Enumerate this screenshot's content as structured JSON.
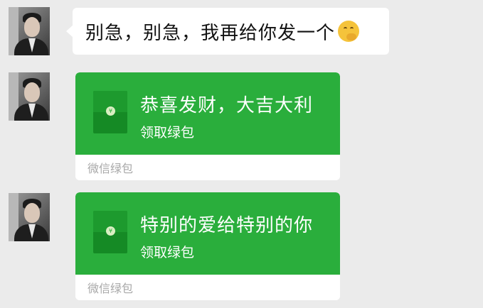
{
  "messages": [
    {
      "type": "text",
      "text": "别急，别急，我再给你发一个",
      "emoji": "thinking-face-emoji"
    },
    {
      "type": "green-packet",
      "title": "恭喜发财，大吉大利",
      "action": "领取绿包",
      "footer": "微信绿包"
    },
    {
      "type": "green-packet",
      "title": "特别的爱给特别的你",
      "action": "领取绿包",
      "footer": "微信绿包"
    }
  ],
  "colors": {
    "background": "#ebebeb",
    "packet_green": "#2aae3c",
    "packet_icon": "#158a25",
    "bubble_white": "#ffffff",
    "footer_text": "#a8a8a8"
  }
}
